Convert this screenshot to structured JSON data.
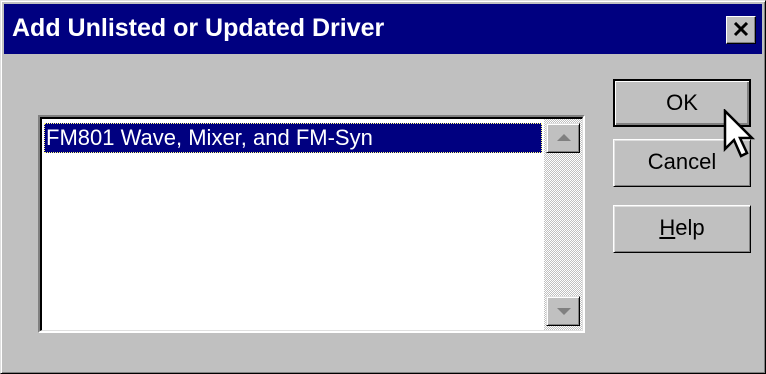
{
  "window": {
    "title": "Add Unlisted or Updated Driver"
  },
  "listbox": {
    "items": [
      {
        "label": "FM801 Wave, Mixer, and FM-Syn",
        "selected": true
      }
    ]
  },
  "buttons": {
    "ok_label": "OK",
    "cancel_label": "Cancel",
    "help_mnemonic": "H",
    "help_rest": "elp"
  },
  "icons": {
    "close": "close-icon",
    "scroll_up": "arrow-up-icon",
    "scroll_down": "arrow-down-icon",
    "pointer": "mouse-pointer-icon"
  },
  "colors": {
    "titlebar": "#000080",
    "face": "#c0c0c0",
    "selection": "#000080"
  }
}
